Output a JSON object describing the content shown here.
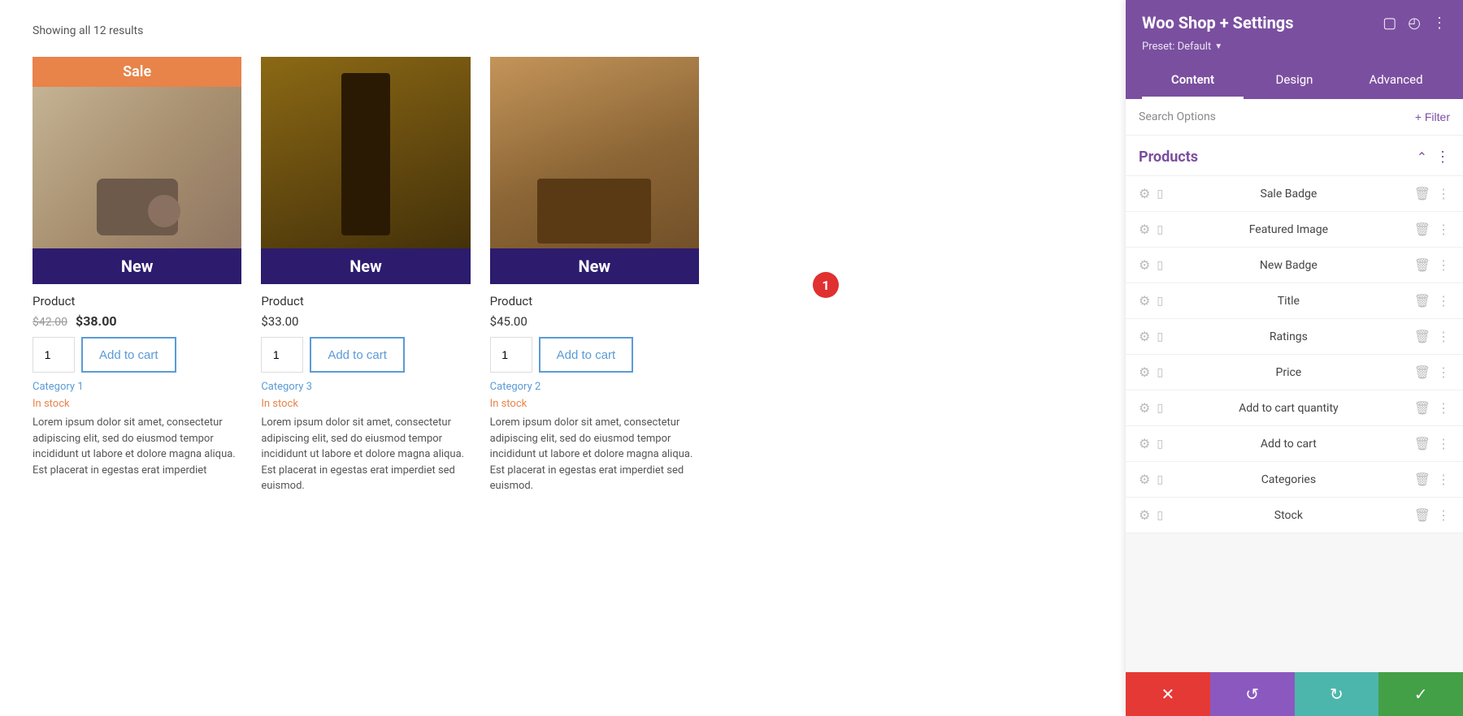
{
  "main": {
    "results_count": "Showing all 12 results",
    "products": [
      {
        "id": 1,
        "has_sale_badge": true,
        "sale_badge": "Sale",
        "has_new_badge": true,
        "new_badge": "New",
        "name": "Product",
        "price_old": "$42.00",
        "price_new": "$38.00",
        "qty": "1",
        "add_to_cart": "Add to cart",
        "category": "Category 1",
        "stock": "In stock",
        "description": "Lorem ipsum dolor sit amet, consectetur adipiscing elit, sed do eiusmod tempor incididunt ut labore et dolore magna aliqua. Est placerat in egestas erat imperdiet"
      },
      {
        "id": 2,
        "has_sale_badge": false,
        "has_new_badge": true,
        "new_badge": "New",
        "name": "Product",
        "price_single": "$33.00",
        "qty": "1",
        "add_to_cart": "Add to cart",
        "category": "Category 3",
        "stock": "In stock",
        "description": "Lorem ipsum dolor sit amet, consectetur adipiscing elit, sed do eiusmod tempor incididunt ut labore et dolore magna aliqua. Est placerat in egestas erat imperdiet sed euismod."
      },
      {
        "id": 3,
        "has_sale_badge": false,
        "has_new_badge": true,
        "new_badge": "New",
        "name": "Product",
        "price_single": "$45.00",
        "qty": "1",
        "add_to_cart": "Add to cart",
        "category": "Category 2",
        "stock": "In stock",
        "description": "Lorem ipsum dolor sit amet, consectetur adipiscing elit, sed do eiusmod tempor incididunt ut labore et dolore magna aliqua. Est placerat in egestas erat imperdiet sed euismod."
      }
    ]
  },
  "panel": {
    "title": "Woo Shop + Settings",
    "preset_label": "Preset: Default",
    "tabs": [
      {
        "id": "content",
        "label": "Content",
        "active": true
      },
      {
        "id": "design",
        "label": "Design",
        "active": false
      },
      {
        "id": "advanced",
        "label": "Advanced",
        "active": false
      }
    ],
    "search_placeholder": "Search Options",
    "filter_label": "+ Filter",
    "products_section": {
      "title": "Products",
      "items": [
        {
          "id": "sale-badge",
          "label": "Sale Badge"
        },
        {
          "id": "featured-image",
          "label": "Featured Image"
        },
        {
          "id": "new-badge",
          "label": "New Badge"
        },
        {
          "id": "title",
          "label": "Title"
        },
        {
          "id": "ratings",
          "label": "Ratings"
        },
        {
          "id": "price",
          "label": "Price"
        },
        {
          "id": "add-to-cart-qty",
          "label": "Add to cart quantity"
        },
        {
          "id": "add-to-cart",
          "label": "Add to cart"
        },
        {
          "id": "categories",
          "label": "Categories"
        },
        {
          "id": "stock",
          "label": "Stock"
        }
      ]
    },
    "toolbar": {
      "close_icon": "✕",
      "undo_icon": "↺",
      "redo_icon": "↻",
      "save_icon": "✓"
    }
  },
  "badge": {
    "number": "1"
  },
  "colors": {
    "purple": "#7b4fa0",
    "orange": "#e8834a",
    "dark_purple": "#2d1b6e",
    "blue_link": "#5b9bd5",
    "green": "#43a047",
    "teal": "#4db6ac",
    "red": "#e53935"
  }
}
